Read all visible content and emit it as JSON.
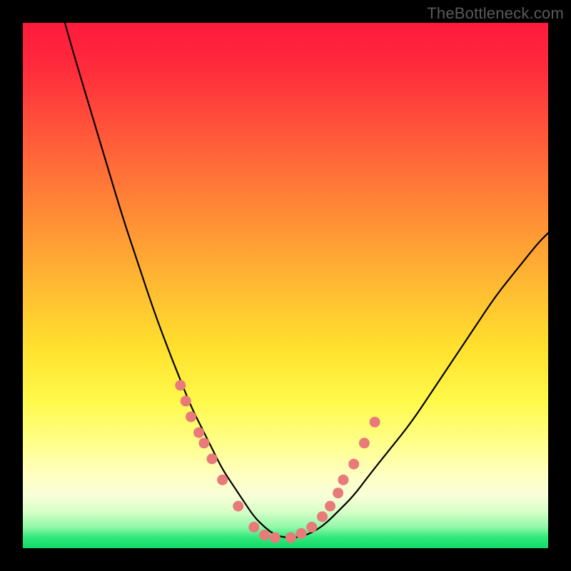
{
  "watermark": "TheBottleneck.com",
  "colors": {
    "background": "#000000",
    "curve_stroke": "#000000",
    "marker_fill": "#e97a7a",
    "marker_stroke": "#c46060",
    "gradient_top": "#ff1a3c",
    "gradient_bottom": "#13d96b"
  },
  "chart_data": {
    "type": "line",
    "title": "",
    "xlabel": "",
    "ylabel": "",
    "xlim": [
      0,
      100
    ],
    "ylim": [
      0,
      100
    ],
    "grid": false,
    "series": [
      {
        "name": "bottleneck-curve",
        "x": [
          8,
          10,
          13,
          16,
          19,
          22,
          25,
          28,
          30,
          32,
          34,
          36,
          38,
          40,
          42,
          44,
          46,
          48,
          50,
          52,
          54,
          56,
          58,
          60,
          63,
          66,
          70,
          74,
          78,
          82,
          86,
          90,
          94,
          98,
          100
        ],
        "y": [
          100,
          93,
          83,
          73,
          63,
          54,
          45,
          37,
          32,
          27,
          23,
          19,
          15,
          12,
          9,
          6,
          4,
          2.5,
          2,
          2,
          2.5,
          3.5,
          5,
          7,
          10,
          14,
          19,
          24,
          30,
          36,
          42,
          48,
          53,
          58,
          60
        ]
      }
    ],
    "markers": {
      "name": "sample-points",
      "note": "values estimated from pixel positions on an unlabeled axis; x and y are in percent of plot width/height",
      "x": [
        30,
        31,
        32,
        33.5,
        34.5,
        36,
        38,
        41,
        44,
        46,
        48,
        51,
        53,
        55,
        57,
        58.5,
        60,
        61,
        63,
        65,
        67
      ],
      "y": [
        31,
        28,
        25,
        22,
        20,
        17,
        13,
        8,
        4,
        2.5,
        2,
        2,
        2.8,
        4,
        6,
        8,
        10.5,
        13,
        16,
        20,
        24
      ]
    }
  }
}
